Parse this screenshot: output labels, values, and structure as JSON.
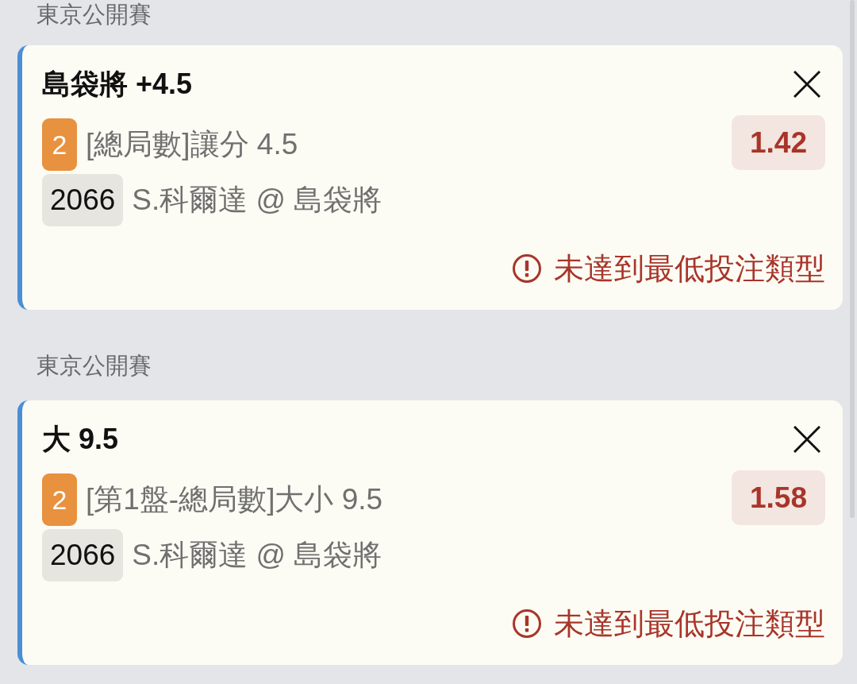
{
  "sections": [
    {
      "league": "東京公開賽",
      "bet": {
        "selection": "島袋將 +4.5",
        "leg_count": "2",
        "market": "[總局數]讓分 4.5",
        "event_code": "2066",
        "match": "S.科爾達 @ 島袋將",
        "odds": "1.42",
        "warning": "未達到最低投注類型"
      }
    },
    {
      "league": "東京公開賽",
      "bet": {
        "selection": "大 9.5",
        "leg_count": "2",
        "market": "[第1盤-總局數]大小 9.5",
        "event_code": "2066",
        "match": "S.科爾達 @ 島袋將",
        "odds": "1.58",
        "warning": "未達到最低投注類型"
      }
    }
  ]
}
